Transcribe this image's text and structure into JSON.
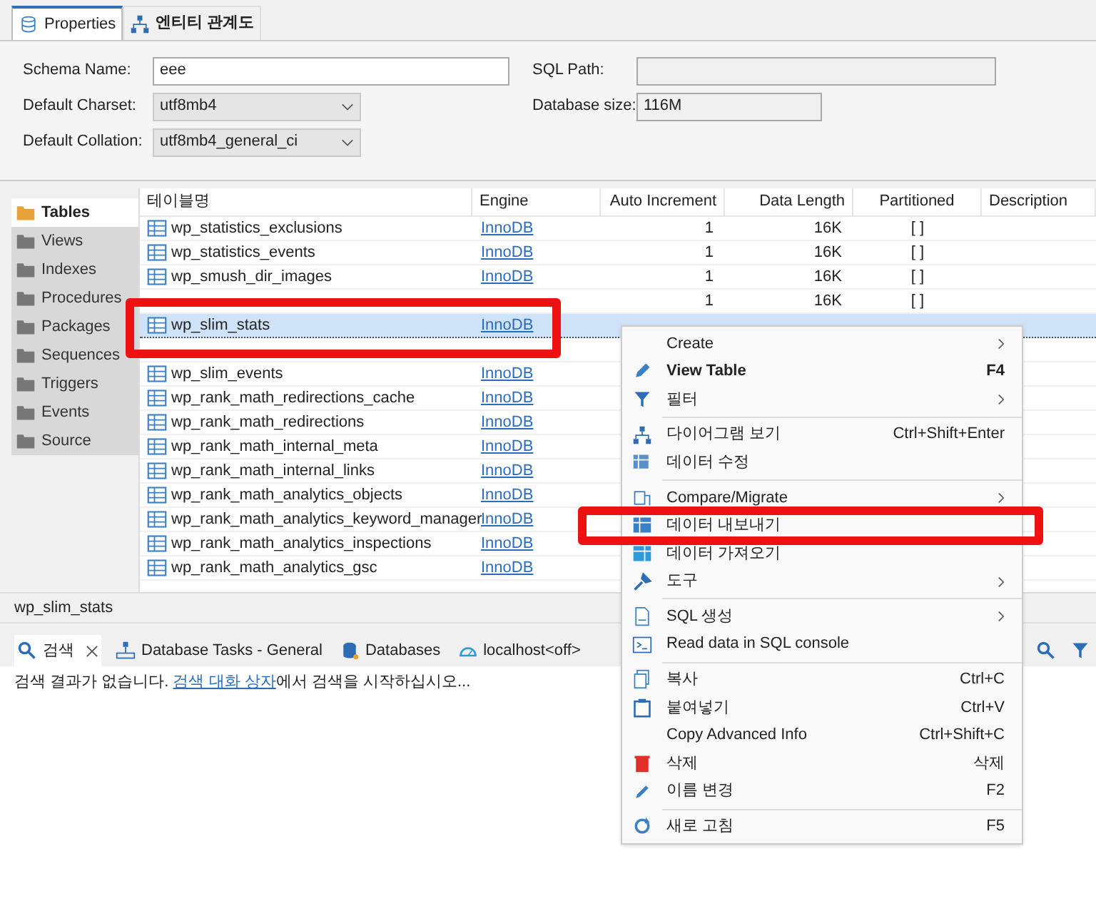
{
  "editor_tabs": [
    {
      "label": "Properties",
      "selected": true
    },
    {
      "label": "엔티티 관계도",
      "selected": false
    }
  ],
  "form": {
    "schema_name": {
      "label": "Schema Name:",
      "value": "eee"
    },
    "default_charset": {
      "label": "Default Charset:",
      "value": "utf8mb4"
    },
    "default_collation": {
      "label": "Default Collation:",
      "value": "utf8mb4_general_ci"
    },
    "sql_path": {
      "label": "SQL Path:"
    },
    "database_size": {
      "label": "Database size:",
      "value": "116M"
    }
  },
  "sidebar": {
    "items": [
      {
        "label": "Tables",
        "selected": true
      },
      {
        "label": "Views",
        "selected": false
      },
      {
        "label": "Indexes",
        "selected": false
      },
      {
        "label": "Procedures",
        "selected": false
      },
      {
        "label": "Packages",
        "selected": false
      },
      {
        "label": "Sequences",
        "selected": false
      },
      {
        "label": "Triggers",
        "selected": false
      },
      {
        "label": "Events",
        "selected": false
      },
      {
        "label": "Source",
        "selected": false
      }
    ]
  },
  "table": {
    "columns": [
      "테이블명",
      "Engine",
      "Auto Increment",
      "Data Length",
      "Partitioned",
      "Description"
    ],
    "rows": [
      {
        "name": "wp_statistics_exclusions",
        "engine": "InnoDB",
        "auto_increment": "1",
        "data_length": "16K",
        "partitioned": "[ ]",
        "selected": false
      },
      {
        "name": "wp_statistics_events",
        "engine": "InnoDB",
        "auto_increment": "1",
        "data_length": "16K",
        "partitioned": "[ ]",
        "selected": false
      },
      {
        "name": "wp_smush_dir_images",
        "engine": "InnoDB",
        "auto_increment": "1",
        "data_length": "16K",
        "partitioned": "[ ]",
        "selected": false
      },
      {
        "auto_increment": "1",
        "data_length": "16K",
        "partitioned": "[ ]",
        "selected": false
      },
      {
        "name": "wp_slim_stats",
        "engine": "InnoDB",
        "selected": true
      },
      {
        "selected": false
      },
      {
        "name": "wp_slim_events",
        "engine": "InnoDB",
        "selected": false
      },
      {
        "name": "wp_rank_math_redirections_cache",
        "engine": "InnoDB",
        "selected": false
      },
      {
        "name": "wp_rank_math_redirections",
        "engine": "InnoDB",
        "selected": false
      },
      {
        "name": "wp_rank_math_internal_meta",
        "engine": "InnoDB",
        "selected": false
      },
      {
        "name": "wp_rank_math_internal_links",
        "engine": "InnoDB",
        "selected": false
      },
      {
        "name": "wp_rank_math_analytics_objects",
        "engine": "InnoDB",
        "selected": false
      },
      {
        "name": "wp_rank_math_analytics_keyword_manager",
        "engine": "InnoDB",
        "selected": false
      },
      {
        "name": "wp_rank_math_analytics_inspections",
        "engine": "InnoDB",
        "selected": false
      },
      {
        "name": "wp_rank_math_analytics_gsc",
        "engine": "InnoDB",
        "selected": false
      }
    ]
  },
  "status_bar": {
    "text": "wp_slim_stats"
  },
  "bottom_tabs": [
    {
      "label": "검색",
      "selected": true,
      "closable": true
    },
    {
      "label": "Database Tasks - General",
      "selected": false,
      "closable": false
    },
    {
      "label": "Databases",
      "selected": false,
      "closable": false
    },
    {
      "label": "localhost<off>",
      "selected": false,
      "closable": false
    }
  ],
  "search_message": {
    "before": "검색 결과가 없습니다. ",
    "link": "검색 대화 상자",
    "after": "에서 검색을 시작하십시오..."
  },
  "context_menu": {
    "groups": [
      [
        {
          "label": "Create",
          "submenu": true
        },
        {
          "label": "View Table",
          "shortcut": "F4",
          "bold": true
        },
        {
          "label": "필터",
          "submenu": true
        }
      ],
      [
        {
          "label": "다이어그램 보기",
          "shortcut": "Ctrl+Shift+Enter"
        },
        {
          "label": "데이터 수정"
        }
      ],
      [
        {
          "label": "Compare/Migrate",
          "submenu": true
        },
        {
          "label": "데이터 내보내기"
        },
        {
          "label": "데이터 가져오기"
        },
        {
          "label": "도구",
          "submenu": true
        }
      ],
      [
        {
          "label": "SQL 생성",
          "submenu": true
        },
        {
          "label": "Read data in SQL console"
        }
      ],
      [
        {
          "label": "복사",
          "shortcut": "Ctrl+C"
        },
        {
          "label": "붙여넣기",
          "shortcut": "Ctrl+V"
        },
        {
          "label": "Copy Advanced Info",
          "shortcut": "Ctrl+Shift+C"
        },
        {
          "label": "삭제",
          "shortcut": "삭제"
        },
        {
          "label": "이름 변경",
          "shortcut": "F2"
        }
      ],
      [
        {
          "label": "새로 고침",
          "shortcut": "F5"
        }
      ]
    ]
  }
}
